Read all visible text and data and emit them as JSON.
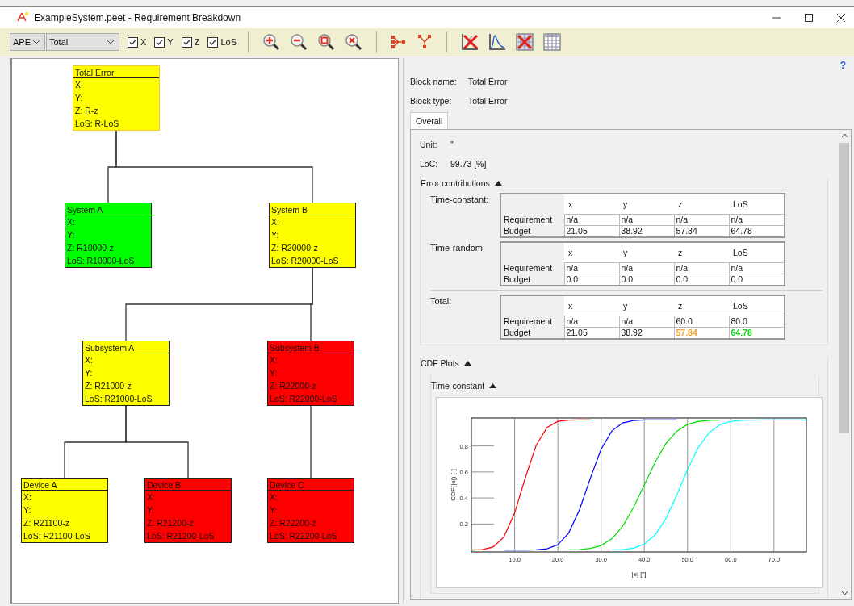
{
  "window": {
    "title": "ExampleSystem.peet - Requirement Breakdown"
  },
  "toolbar": {
    "dropdowns": [
      {
        "value": "APE"
      },
      {
        "value": "Total"
      }
    ],
    "checkboxes": [
      {
        "label": "X",
        "checked": true
      },
      {
        "label": "Y",
        "checked": true
      },
      {
        "label": "Z",
        "checked": true
      },
      {
        "label": "LoS",
        "checked": true
      }
    ]
  },
  "tree": {
    "name": "Total Error",
    "color": "#ffff00",
    "selected": true,
    "rows": [
      "X:",
      "Y:",
      "Z: R-z",
      "LoS: R-LoS"
    ],
    "children": [
      {
        "name": "System A",
        "color": "#00ff00",
        "selected": false,
        "rows": [
          "X:",
          "Y:",
          "Z: R10000-z",
          "LoS: R10000-LoS"
        ]
      },
      {
        "name": "System B",
        "color": "#ffff00",
        "selected": false,
        "rows": [
          "X:",
          "Y:",
          "Z: R20000-z",
          "LoS: R20000-LoS"
        ],
        "children": [
          {
            "name": "Subsystem A",
            "color": "#ffff00",
            "selected": false,
            "rows": [
              "X:",
              "Y:",
              "Z: R21000-z",
              "LoS: R21000-LoS"
            ],
            "children": [
              {
                "name": "Device A",
                "color": "#ffff00",
                "selected": false,
                "rows": [
                  "X:",
                  "Y:",
                  "Z: R21100-z",
                  "LoS: R21100-LoS"
                ]
              },
              {
                "name": "Device B",
                "color": "#ff0000",
                "selected": false,
                "rows": [
                  "X:",
                  "Y:",
                  "Z: R21200-z",
                  "LoS: R21200-LoS"
                ]
              }
            ]
          },
          {
            "name": "Subsystem B",
            "color": "#ff0000",
            "selected": false,
            "rows": [
              "X:",
              "Y:",
              "Z: R22000-z",
              "LoS: R22000-LoS"
            ],
            "children": [
              {
                "name": "Device C",
                "color": "#ff0000",
                "selected": false,
                "rows": [
                  "X:",
                  "Y:",
                  "Z: R22200-z",
                  "LoS: R22200-LoS"
                ]
              }
            ]
          }
        ]
      }
    ]
  },
  "details": {
    "help": "?",
    "fields": [
      {
        "label": "Block name:",
        "value": "Total Error"
      },
      {
        "label": "Block type:",
        "value": "Total Error"
      }
    ],
    "tabs": [
      {
        "label": "Overall",
        "selected": true
      }
    ],
    "info": [
      {
        "label": "Unit:",
        "value": "\""
      },
      {
        "label": "LoC:",
        "value": "99.73 [%]"
      }
    ],
    "error_contributions": {
      "title": "Error contributions",
      "expanded": true,
      "groups": [
        {
          "label": "Time-constant:",
          "kind": "component",
          "columns": [
            "x",
            "y",
            "z",
            "LoS"
          ],
          "rows": [
            {
              "label": "Requirement",
              "cells": [
                {
                  "text": "n/a"
                },
                {
                  "text": "n/a"
                },
                {
                  "text": "n/a"
                },
                {
                  "text": "n/a"
                }
              ]
            },
            {
              "label": "Budget",
              "cells": [
                {
                  "text": "21.05"
                },
                {
                  "text": "38.92"
                },
                {
                  "text": "57.84"
                },
                {
                  "text": "64.78"
                }
              ]
            }
          ]
        },
        {
          "label": "Time-random:",
          "kind": "component",
          "columns": [
            "x",
            "y",
            "z",
            "LoS"
          ],
          "rows": [
            {
              "label": "Requirement",
              "cells": [
                {
                  "text": "n/a"
                },
                {
                  "text": "n/a"
                },
                {
                  "text": "n/a"
                },
                {
                  "text": "n/a"
                }
              ]
            },
            {
              "label": "Budget",
              "cells": [
                {
                  "text": "0.0"
                },
                {
                  "text": "0.0"
                },
                {
                  "text": "0.0"
                },
                {
                  "text": "0.0"
                }
              ]
            }
          ]
        },
        {
          "label": "Total:",
          "kind": "total",
          "columns": [
            "x",
            "y",
            "z",
            "LoS"
          ],
          "rows": [
            {
              "label": "Requirement",
              "cells": [
                {
                  "text": "n/a"
                },
                {
                  "text": "n/a"
                },
                {
                  "text": "60.0"
                },
                {
                  "text": "80.0"
                }
              ]
            },
            {
              "label": "Budget",
              "cells": [
                {
                  "text": "21.05"
                },
                {
                  "text": "38.92"
                },
                {
                  "text": "57.84",
                  "color": "#f5a030"
                },
                {
                  "text": "64.78",
                  "color": "#22cc22"
                }
              ]
            }
          ]
        }
      ]
    },
    "cdf_plots": {
      "title": "CDF Plots",
      "expanded": true,
      "sections": [
        {
          "title": "Time-constant",
          "expanded": true,
          "chart_data": {
            "type": "line",
            "grid": true,
            "xlabel": "|e| [\"]",
            "ylabel": "CDF(|e|) [-]",
            "xlim": [
              0,
              77.5
            ],
            "ylim": [
              -0.015,
              1.015
            ],
            "xticks": [
              {
                "value": 10,
                "label": "10.0"
              },
              {
                "value": 20,
                "label": "20.0"
              },
              {
                "value": 30,
                "label": "30.0"
              },
              {
                "value": 40,
                "label": "40.0"
              },
              {
                "value": 50,
                "label": "50.0"
              },
              {
                "value": 60,
                "label": "60.0"
              },
              {
                "value": 70,
                "label": "70.0"
              }
            ],
            "yticks": [
              0.2,
              0.4,
              0.6,
              0.8
            ],
            "x": [
              0,
              2.5,
              5,
              7.5,
              10,
              12.5,
              15,
              17.5,
              20,
              22.5,
              25,
              27.5,
              30,
              32.5,
              35,
              37.5,
              40,
              42.5,
              45,
              47.5,
              50,
              52.5,
              55,
              57.5,
              60,
              62.5,
              65,
              67.5,
              70,
              72.5,
              75,
              77.5
            ],
            "series": [
              {
                "color": "#ff0000",
                "values": [
                  0,
                  0.003,
                  0.023,
                  0.099,
                  0.284,
                  0.557,
                  0.805,
                  0.942,
                  0.989,
                  0.999,
                  1,
                  1,
                  null,
                  null,
                  null,
                  null,
                  null,
                  null,
                  null,
                  null,
                  null,
                  null,
                  null,
                  null,
                  null,
                  null,
                  null,
                  null,
                  null,
                  null,
                  null,
                  null
                ]
              },
              {
                "color": "#0000ff",
                "values": [
                  null,
                  null,
                  null,
                  0,
                  0,
                  0,
                  0.001,
                  0.009,
                  0.04,
                  0.13,
                  0.309,
                  0.55,
                  0.773,
                  0.915,
                  0.977,
                  0.996,
                  1,
                  1,
                  1,
                  1,
                  null,
                  null,
                  null,
                  null,
                  null,
                  null,
                  null,
                  null,
                  null,
                  null,
                  null,
                  null
                ]
              },
              {
                "color": "#00e000",
                "values": [
                  null,
                  null,
                  null,
                  null,
                  null,
                  null,
                  null,
                  null,
                  null,
                  0.001,
                  0.003,
                  0.012,
                  0.034,
                  0.087,
                  0.181,
                  0.326,
                  0.5,
                  0.674,
                  0.819,
                  0.913,
                  0.966,
                  0.988,
                  0.997,
                  0.999,
                  null,
                  null,
                  null,
                  null,
                  null,
                  null,
                  null,
                  null
                ]
              },
              {
                "color": "#00ffff",
                "values": [
                  null,
                  null,
                  null,
                  null,
                  null,
                  null,
                  null,
                  null,
                  null,
                  null,
                  null,
                  null,
                  null,
                  0.001,
                  0.003,
                  0.014,
                  0.045,
                  0.115,
                  0.242,
                  0.421,
                  0.618,
                  0.788,
                  0.903,
                  0.964,
                  0.989,
                  0.997,
                  0.999,
                  1,
                  1,
                  1,
                  1,
                  1
                ]
              }
            ]
          }
        }
      ]
    }
  }
}
